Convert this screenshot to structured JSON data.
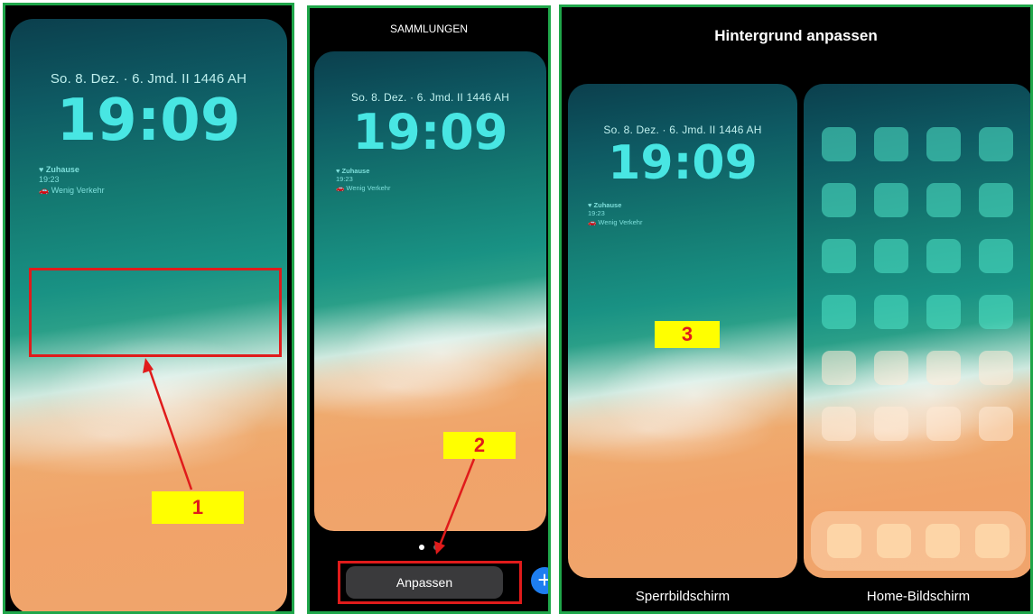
{
  "lock": {
    "date": "So. 8. Dez. · 6. Jmd. II 1446 AH",
    "time": "19:09",
    "widget_place": "♥ Zuhause",
    "widget_time": "19:23",
    "widget_traffic": "🚗 Wenig Verkehr"
  },
  "panel1": {
    "step": "1"
  },
  "panel2": {
    "header": "SAMMLUNGEN",
    "button": "Anpassen",
    "plus": "+",
    "step": "2"
  },
  "panel3": {
    "header": "Hintergrund anpassen",
    "lock_caption": "Sperrbildschirm",
    "home_caption": "Home-Bildschirm",
    "step": "3"
  },
  "colors": {
    "frame": "#1fa64a",
    "annotation": "#e01b1b",
    "tag_bg": "#ffff00",
    "accent_blue": "#1e7ef0"
  }
}
